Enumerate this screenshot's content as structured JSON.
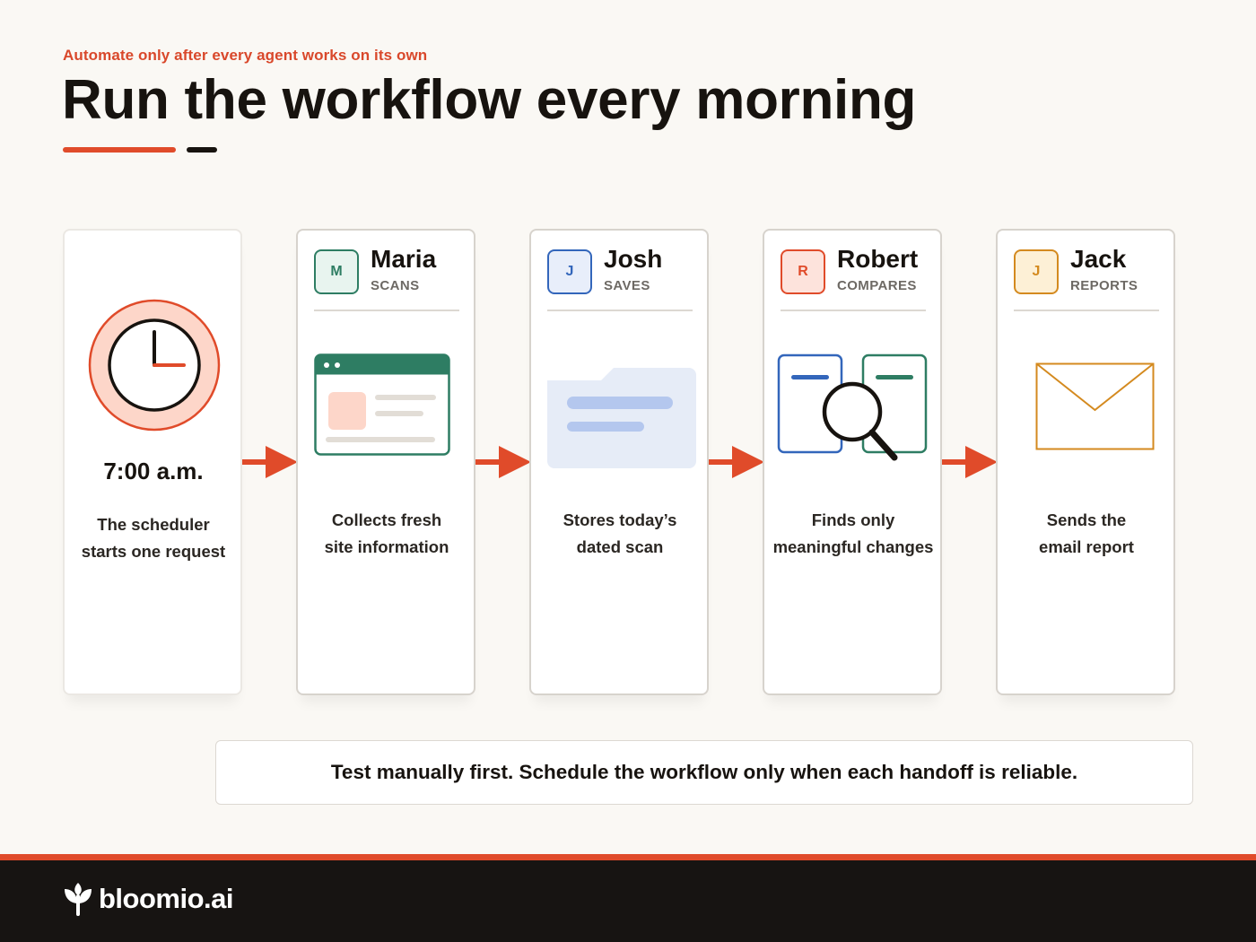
{
  "header": {
    "eyebrow": "Automate only after every agent works on its own",
    "title": "Run the workflow every morning"
  },
  "scheduler": {
    "time": "7:00 a.m.",
    "description_lines": [
      "The scheduler",
      "starts one request"
    ]
  },
  "agents": [
    {
      "initial": "M",
      "name": "Maria",
      "role": "SCANS",
      "description_lines": [
        "Collects fresh",
        "site information"
      ],
      "accent": "#2e7d63",
      "badge_bg": "#e8f4ef"
    },
    {
      "initial": "J",
      "name": "Josh",
      "role": "SAVES",
      "description_lines": [
        "Stores today’s",
        "dated scan"
      ],
      "accent": "#3366bb",
      "badge_bg": "#e8eefa"
    },
    {
      "initial": "R",
      "name": "Robert",
      "role": "COMPARES",
      "description_lines": [
        "Finds only",
        "meaningful changes"
      ],
      "accent": "#e04b2a",
      "badge_bg": "#fde3dc"
    },
    {
      "initial": "J",
      "name": "Jack",
      "role": "REPORTS",
      "description_lines": [
        "Sends the",
        "email report"
      ],
      "accent": "#d48a1f",
      "badge_bg": "#fdf0d6"
    }
  ],
  "note": "Test manually first. Schedule the workflow only when each handoff is reliable.",
  "footer": {
    "brand": "bloomio.ai"
  },
  "colors": {
    "accent_red": "#e04b2a",
    "dark": "#171412",
    "background": "#faf8f4"
  }
}
